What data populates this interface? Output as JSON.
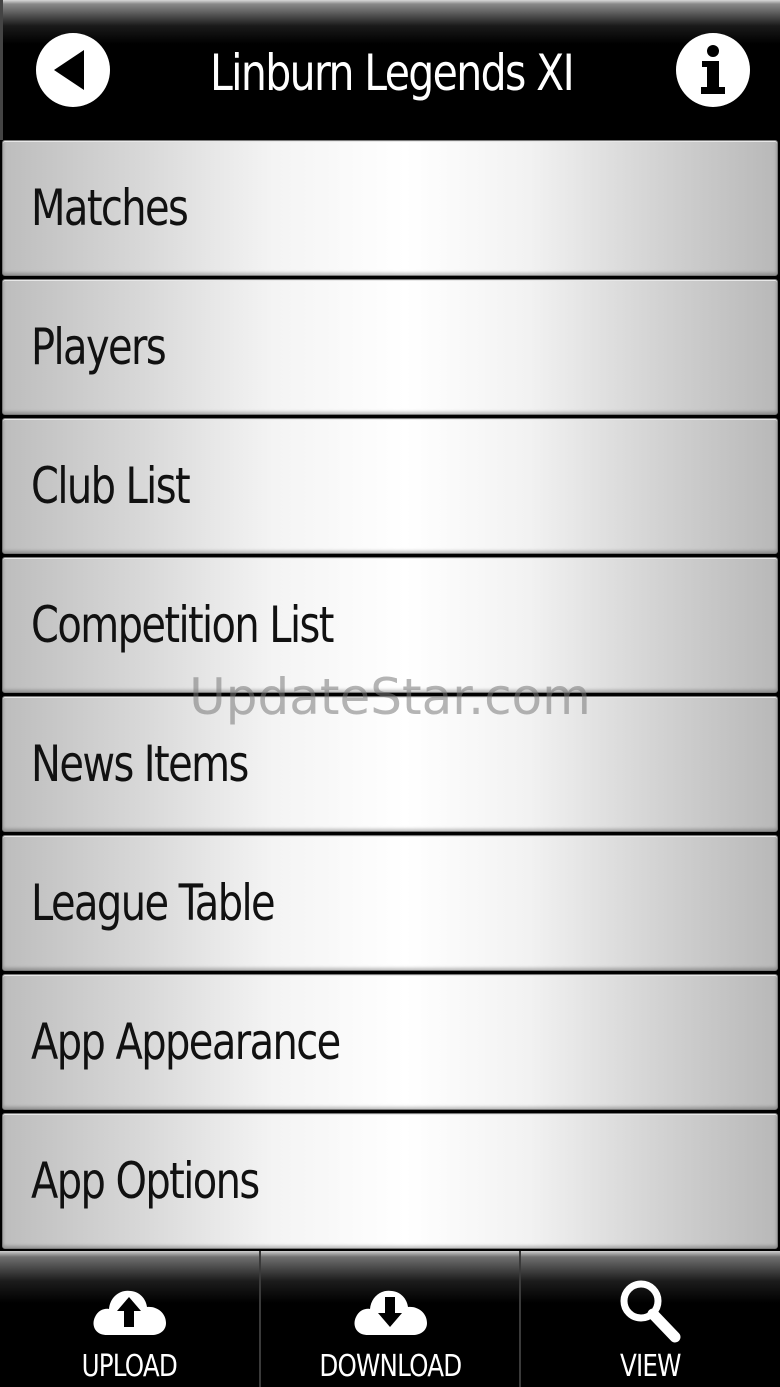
{
  "header": {
    "title": "Linburn Legends XI",
    "back_icon": "back-arrow-icon",
    "info_icon": "info-icon"
  },
  "menu": {
    "items": [
      {
        "label": "Matches"
      },
      {
        "label": "Players"
      },
      {
        "label": "Club List"
      },
      {
        "label": "Competition List"
      },
      {
        "label": "News Items"
      },
      {
        "label": "League Table"
      },
      {
        "label": "App Appearance"
      },
      {
        "label": "App Options"
      }
    ]
  },
  "watermark": "UpdateStar.com",
  "bottom_bar": {
    "tabs": [
      {
        "label": "UPLOAD",
        "icon": "cloud-upload-icon"
      },
      {
        "label": "DOWNLOAD",
        "icon": "cloud-download-icon"
      },
      {
        "label": "VIEW",
        "icon": "magnifier-icon"
      }
    ]
  },
  "colors": {
    "header_bg": "#000000",
    "item_center": "#ffffff",
    "item_edge": "#b8b8b8",
    "text": "#111111"
  }
}
